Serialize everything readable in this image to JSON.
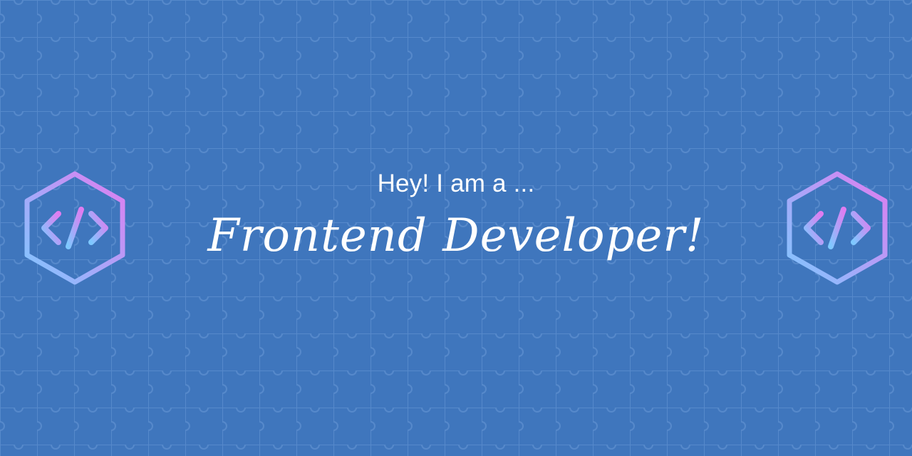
{
  "banner": {
    "greeting": "Hey! I am a ...",
    "role": "Frontend Developer!"
  },
  "logos": {
    "left_icon": "code-hexagon-icon",
    "right_icon": "code-hexagon-icon",
    "gradient_start": "#7ec8ff",
    "gradient_end": "#e07cf0"
  },
  "colors": {
    "background": "#3f76bd",
    "pattern_line": "#5a8ccd",
    "text": "#ffffff"
  }
}
